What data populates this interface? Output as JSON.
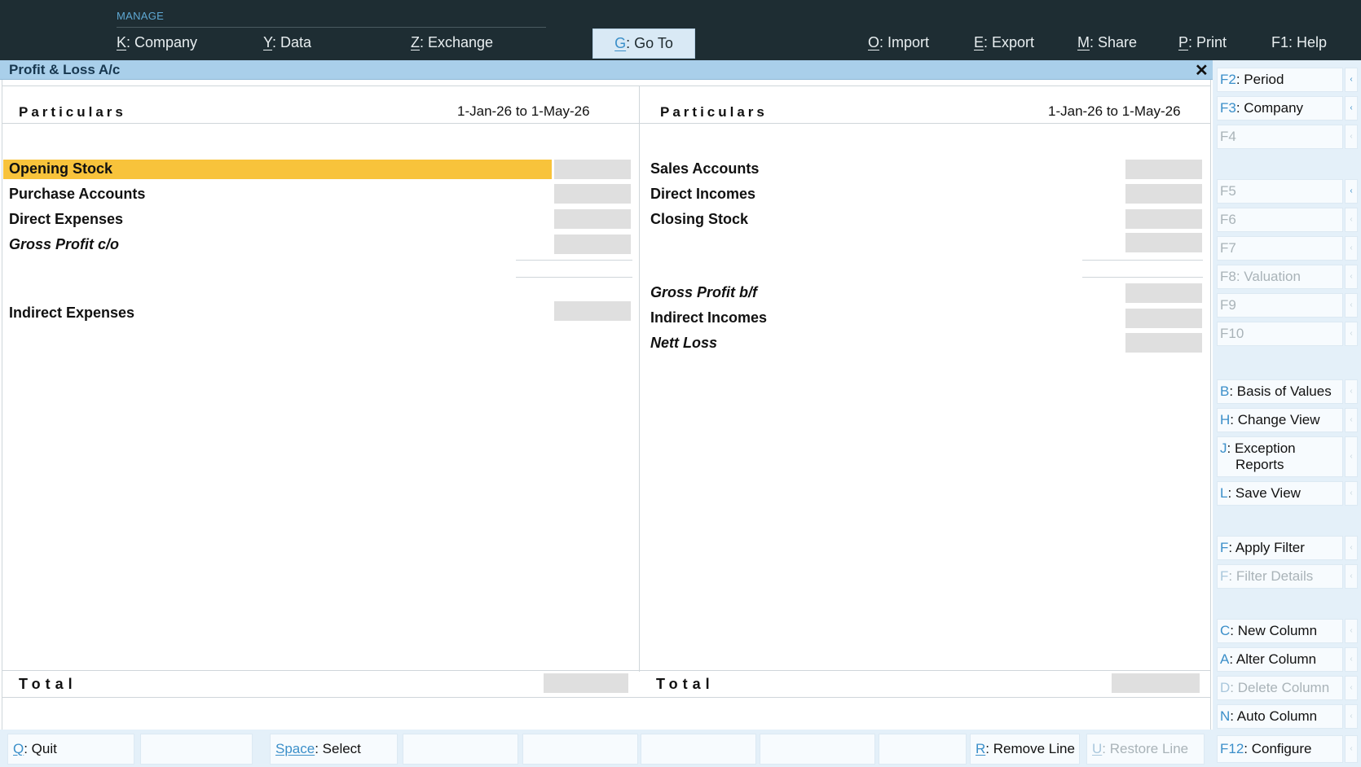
{
  "top_menu": {
    "section_label": "MANAGE",
    "items": [
      {
        "key": "K",
        "label": ": Company"
      },
      {
        "key": "Y",
        "label": ": Data"
      },
      {
        "key": "Z",
        "label": ": Exchange"
      },
      {
        "key": "G",
        "label": ": Go To"
      },
      {
        "key": "O",
        "label": ": Import"
      },
      {
        "key": "E",
        "label": ": Export"
      },
      {
        "key": "M",
        "label": ": Share"
      },
      {
        "key": "P",
        "label": ": Print"
      },
      {
        "key": "F1",
        "label": ": Help"
      }
    ]
  },
  "window": {
    "title": "Profit & Loss A/c",
    "close_icon": "close-icon"
  },
  "report": {
    "left": {
      "header": "Particulars",
      "period": "1-Jan-26 to 1-May-26",
      "rows": [
        "Opening Stock",
        "Purchase Accounts",
        "Direct Expenses",
        "Gross Profit c/o",
        "Indirect Expenses"
      ],
      "total_label": "Total"
    },
    "right": {
      "header": "Particulars",
      "period": "1-Jan-26 to 1-May-26",
      "rows": [
        "Sales Accounts",
        "Direct Incomes",
        "Closing Stock",
        "Gross Profit b/f",
        "Indirect Incomes",
        "Nett Loss"
      ],
      "total_label": "Total"
    },
    "highlight_color": "#f8c33b"
  },
  "side_panel": [
    {
      "key": "F2",
      "label": ": Period"
    },
    {
      "key": "F3",
      "label": ": Company"
    },
    {
      "key": "F4",
      "label": ""
    },
    {
      "key": "F5",
      "label": ""
    },
    {
      "key": "F6",
      "label": ""
    },
    {
      "key": "F7",
      "label": ""
    },
    {
      "key": "F8",
      "label": ": Valuation"
    },
    {
      "key": "F9",
      "label": ""
    },
    {
      "key": "F10",
      "label": ""
    },
    {
      "key": "B",
      "label": ": Basis of Values"
    },
    {
      "key": "H",
      "label": ": Change View"
    },
    {
      "key": "J",
      "label": ": Exception",
      "label2": "Reports"
    },
    {
      "key": "L",
      "label": ": Save View"
    },
    {
      "key": "F",
      "label": ": Apply Filter"
    },
    {
      "key": "F",
      "label": ": Filter Details"
    },
    {
      "key": "C",
      "label": ": New Column"
    },
    {
      "key": "A",
      "label": ": Alter Column"
    },
    {
      "key": "D",
      "label": ": Delete Column"
    },
    {
      "key": "N",
      "label": ": Auto Column"
    },
    {
      "key": "F12",
      "label": ": Configure"
    }
  ],
  "bottom_bar": [
    {
      "key": "Q",
      "label": ": Quit"
    },
    {
      "key": "Space",
      "label": ": Select"
    },
    {
      "key": "R",
      "label": ": Remove Line"
    },
    {
      "key": "U",
      "label": ": Restore Line"
    }
  ]
}
